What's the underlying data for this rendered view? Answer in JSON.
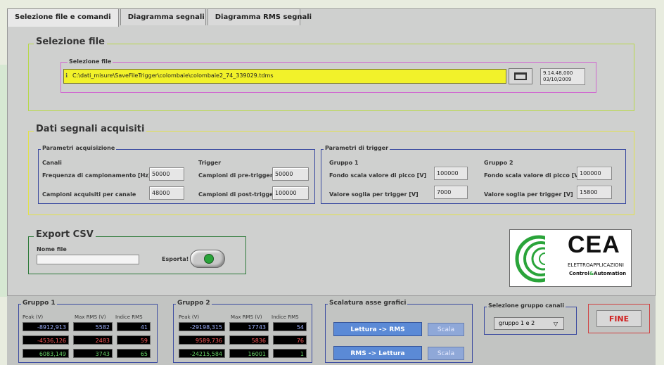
{
  "tabs": [
    {
      "label": "Selezione file e comandi"
    },
    {
      "label": "Diagramma segnali"
    },
    {
      "label": "Diagramma RMS segnali"
    }
  ],
  "file_section": {
    "title": "Selezione file",
    "label": "Selezione file",
    "path": "C:\\dati_misure\\SaveFileTrigger\\colombaie\\colombaie2_74_339029.tdms",
    "time": "9.14.48,000",
    "date": "03/10/2009"
  },
  "dati": {
    "title": "Dati segnali acquisiti",
    "params": {
      "title": "Parametri acquisizione",
      "canali_label": "Canali",
      "freq_label": "Frequenza di campionamento [Hz]",
      "freq_value": "50000",
      "campioni_label": "Campioni acquisiti per canale",
      "campioni_value": "48000",
      "trigger_label": "Trigger",
      "pre_label": "Campioni di pre-trigger",
      "pre_value": "50000",
      "post_label": "Campioni di post-trigger",
      "post_value": "100000"
    },
    "trigger": {
      "title": "Parametri di trigger",
      "g1_label": "Gruppo 1",
      "g1_fondo_label": "Fondo scala valore di picco [V]",
      "g1_fondo_value": "100000",
      "g1_soglia_label": "Valore soglia per trigger [V]",
      "g1_soglia_value": "7000",
      "g2_label": "Gruppo 2",
      "g2_fondo_label": "Fondo scala valore di picco [V]",
      "g2_fondo_value": "100000",
      "g2_soglia_label": "Valore soglia per trigger [V]",
      "g2_soglia_value": "15800"
    }
  },
  "export": {
    "title": "Export CSV",
    "nome_label": "Nome file",
    "nome_value": "",
    "esporta_label": "Esporta!"
  },
  "logo": {
    "brand": "CEA",
    "line1": "ELETTROAPPLICAZIONI",
    "line2a": "Control",
    "amp": "&",
    "line2b": "Automation"
  },
  "gruppo1": {
    "title": "Gruppo 1",
    "headers": [
      "Peak (V)",
      "Max RMS (V)",
      "Indice RMS"
    ],
    "rows": [
      {
        "peak": "-8912,913",
        "max": "5582",
        "idx": "41"
      },
      {
        "peak": "-4536,126",
        "max": "2483",
        "idx": "59"
      },
      {
        "peak": "6083,149",
        "max": "3743",
        "idx": "65"
      }
    ]
  },
  "gruppo2": {
    "title": "Gruppo 2",
    "headers": [
      "Peak (V)",
      "Max RMS (V)",
      "Indice RMS"
    ],
    "rows": [
      {
        "peak": "-29198,315",
        "max": "17743",
        "idx": "54"
      },
      {
        "peak": "9589,736",
        "max": "5836",
        "idx": "76"
      },
      {
        "peak": "-24215,584",
        "max": "16001",
        "idx": "1"
      }
    ]
  },
  "scalatura": {
    "title": "Scalatura asse grafici",
    "btn1": "Lettura -> RMS",
    "btn2": "RMS -> Lettura",
    "scala": "Scala"
  },
  "selezione_gruppo": {
    "title": "Selezione gruppo canali",
    "value": "gruppo 1 e 2"
  },
  "fine": "FINE",
  "colors": {
    "row_colors": [
      "#9fb2ff",
      "#ff5a5a",
      "#66d066"
    ],
    "accent_yellow": "#f2f22a",
    "blue_btn": "#5b8ad6"
  }
}
